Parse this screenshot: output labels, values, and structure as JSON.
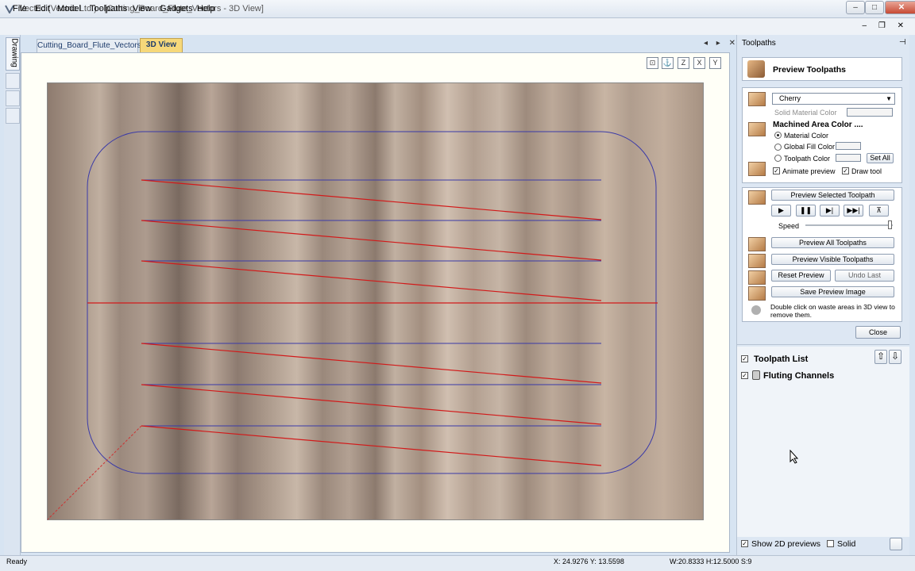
{
  "window": {
    "title": "Vectric (Vectric Ltd.) - [Cutting_Board_Flute_Vectors - 3D View]",
    "min": "–",
    "max": "□",
    "close": "✕"
  },
  "menu": [
    "File",
    "Edit",
    "Model",
    "Toolpaths",
    "View",
    "Gadgets",
    "Help"
  ],
  "doc_controls": "– ❐ ✕",
  "side_tab": "Drawing",
  "tabs": {
    "vectors": "Cutting_Board_Flute_Vectors",
    "view3d": "3D View",
    "nav": "◂ ▸ ✕"
  },
  "view_toolbar": [
    "⊡",
    "⚓",
    "Z",
    "X",
    "Y"
  ],
  "panel": {
    "title": "Toolpaths",
    "pin": "⊣",
    "header": "Preview Toolpaths",
    "material": "Cherry",
    "solid_material_color": "Solid Material Color",
    "machined_area": "Machined Area Color ....",
    "radios": [
      "Material Color",
      "Global Fill Color",
      "Toolpath Color"
    ],
    "set_all": "Set All",
    "animate": "Animate preview",
    "draw_tool": "Draw tool",
    "preview_selected": "Preview Selected Toolpath",
    "media": [
      "▶",
      "❚❚",
      "▶|",
      "▶▶|",
      "⊼"
    ],
    "speed": "Speed",
    "preview_all": "Preview All Toolpaths",
    "preview_visible": "Preview Visible Toolpaths",
    "reset": "Reset Preview",
    "undo": "Undo Last",
    "save": "Save Preview Image",
    "hint": "Double click on waste areas in 3D view to remove them.",
    "close": "Close"
  },
  "list": {
    "header": "Toolpath List",
    "item": "Fluting Channels",
    "arrows": [
      "⇧",
      "⇩"
    ]
  },
  "footer": {
    "show2d": "Show 2D previews",
    "solid": "Solid"
  },
  "status": {
    "ready": "Ready",
    "coords": "X: 24.9276 Y: 13.5598",
    "dims": "W:20.8333  H:12.5000  S:9"
  }
}
